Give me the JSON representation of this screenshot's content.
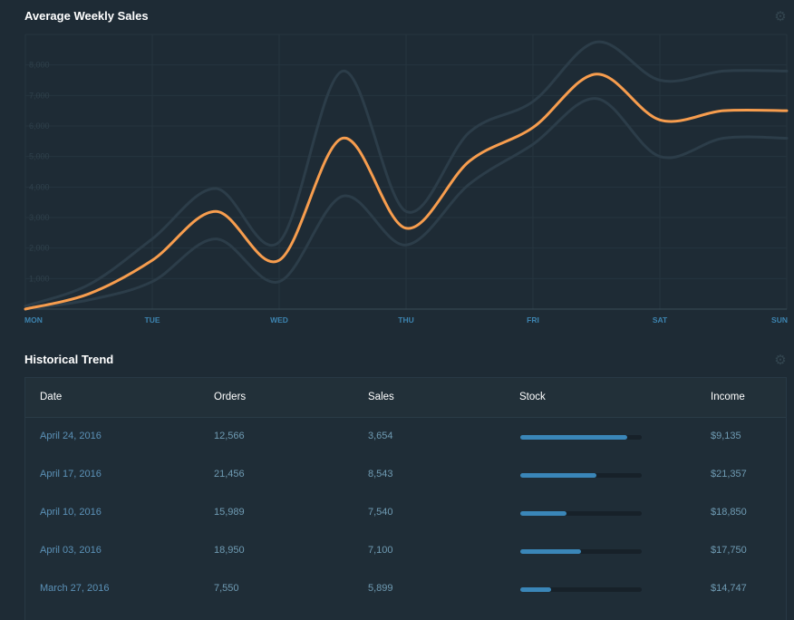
{
  "chart_panel": {
    "title": "Average Weekly Sales",
    "settings_icon": "gear-icon"
  },
  "chart_data": {
    "type": "line",
    "title": "Average Weekly Sales",
    "x_tick_labels": [
      "MON",
      "TUE",
      "WED",
      "THU",
      "FRI",
      "SAT",
      "SUN"
    ],
    "y_tick_labels": [
      "1,000",
      "2,000",
      "3,000",
      "4,000",
      "5,000",
      "6,000",
      "7,000",
      "8,000"
    ],
    "ylim": [
      0,
      9000
    ],
    "xlim": [
      0,
      6
    ],
    "grid": true,
    "series": [
      {
        "role": "main",
        "color": "#f79d4e",
        "x": [
          0,
          0.5,
          1,
          1.5,
          2,
          2.5,
          3,
          3.5,
          4,
          4.5,
          5,
          5.5,
          6
        ],
        "y": [
          0,
          500,
          1600,
          3200,
          1600,
          5600,
          2650,
          4850,
          5950,
          7700,
          6200,
          6500,
          6500
        ]
      },
      {
        "role": "upper-band",
        "color": "#2c3d49",
        "x": [
          0,
          0.5,
          1,
          1.5,
          2,
          2.5,
          3,
          3.5,
          4,
          4.5,
          5,
          5.5,
          6
        ],
        "y": [
          100,
          800,
          2300,
          3950,
          2200,
          7800,
          3200,
          5800,
          6800,
          8750,
          7500,
          7800,
          7800
        ]
      },
      {
        "role": "lower-band",
        "color": "#2c3d49",
        "x": [
          0,
          0.5,
          1,
          1.5,
          2,
          2.5,
          3,
          3.5,
          4,
          4.5,
          5,
          5.5,
          6
        ],
        "y": [
          0,
          300,
          900,
          2300,
          900,
          3700,
          2100,
          4100,
          5400,
          6900,
          5000,
          5600,
          5600
        ]
      }
    ]
  },
  "table_panel": {
    "title": "Historical Trend",
    "settings_icon": "gear-icon",
    "columns": [
      "Date",
      "Orders",
      "Sales",
      "Stock",
      "Income"
    ],
    "rows": [
      {
        "date": "April 24, 2016",
        "orders": "12,566",
        "sales": "3,654",
        "stock": 0.88,
        "income": "$9,135"
      },
      {
        "date": "April 17, 2016",
        "orders": "21,456",
        "sales": "8,543",
        "stock": 0.63,
        "income": "$21,357"
      },
      {
        "date": "April 10, 2016",
        "orders": "15,989",
        "sales": "7,540",
        "stock": 0.38,
        "income": "$18,850"
      },
      {
        "date": "April 03, 2016",
        "orders": "18,950",
        "sales": "7,100",
        "stock": 0.5,
        "income": "$17,750"
      },
      {
        "date": "March 27, 2016",
        "orders": "7,550",
        "sales": "5,899",
        "stock": 0.25,
        "income": "$14,747"
      }
    ]
  }
}
